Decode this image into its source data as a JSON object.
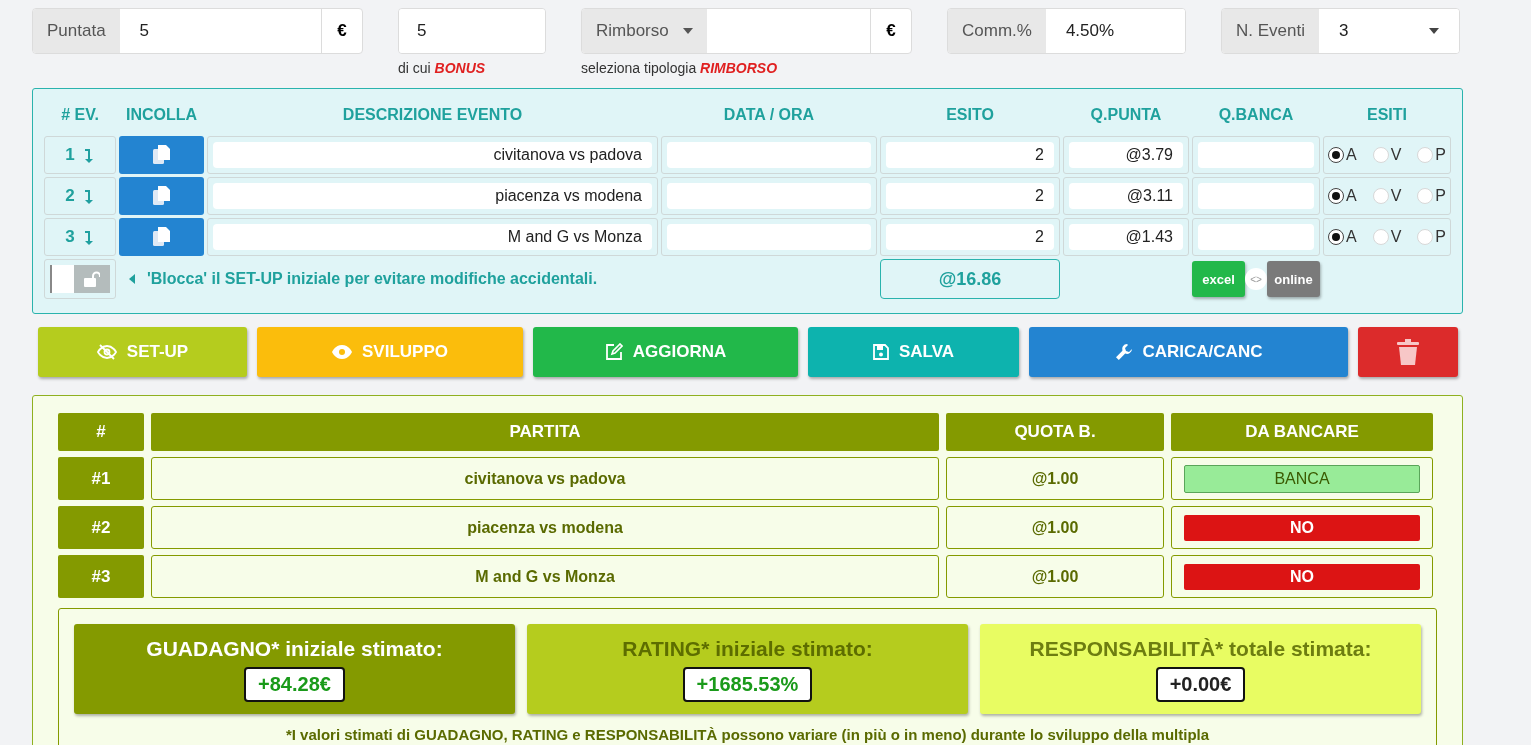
{
  "stake": {
    "label": "Puntata",
    "value": "5",
    "currency": "€"
  },
  "bonus": {
    "value": "5",
    "note_prefix": "di cui",
    "note_highlight": "BONUS"
  },
  "refund": {
    "label": "Rimborso",
    "currency": "€",
    "note_prefix": "seleziona tipologia",
    "note_highlight": "RIMBORSO"
  },
  "commission": {
    "label": "Comm.%",
    "value": "4.50%"
  },
  "event_count": {
    "label": "N. Eventi",
    "value": "3"
  },
  "events_table": {
    "columns": [
      "# EV.",
      "INCOLLA",
      "DESCRIZIONE EVENTO",
      "DATA / ORA",
      "ESITO",
      "Q.PUNTA",
      "Q.BANCA",
      "ESITI"
    ],
    "rows": [
      {
        "number": "1",
        "description": "civitanova vs padova",
        "outcome": "2",
        "q_punta": "@3.79",
        "options": [
          {
            "label": "A",
            "selected": true
          },
          {
            "label": "V",
            "selected": false
          },
          {
            "label": "P",
            "selected": false
          }
        ]
      },
      {
        "number": "2",
        "description": "piacenza vs modena",
        "outcome": "2",
        "q_punta": "@3.11",
        "options": [
          {
            "label": "A",
            "selected": true
          },
          {
            "label": "V",
            "selected": false
          },
          {
            "label": "P",
            "selected": false
          }
        ]
      },
      {
        "number": "3",
        "description": "M and G vs Monza",
        "outcome": "2",
        "q_punta": "@1.43",
        "options": [
          {
            "label": "A",
            "selected": true
          },
          {
            "label": "V",
            "selected": false
          },
          {
            "label": "P",
            "selected": false
          }
        ]
      }
    ],
    "lock": {
      "locked": false,
      "hint": "'Blocca' il SET-UP iniziale per evitare modifiche accidentali."
    },
    "total_odds": "@16.86",
    "switch_knob": "<>",
    "modes": [
      {
        "label": "excel",
        "selected": true
      },
      {
        "label": "online",
        "selected": false
      }
    ]
  },
  "buttons": [
    {
      "kind": "setup",
      "label": "SET-UP",
      "color": "#b5cc1e"
    },
    {
      "kind": "sviluppo",
      "label": "SVILUPPO",
      "color": "#fbbd0c"
    },
    {
      "kind": "aggiorna",
      "label": "AGGIORNA",
      "color": "#22b84a"
    },
    {
      "kind": "salva",
      "label": "SALVA",
      "color": "#0db3ae"
    },
    {
      "kind": "carica",
      "label": "CARICA/CANC",
      "color": "#2384d1"
    },
    {
      "kind": "elimina",
      "color": "#dc2b2b"
    }
  ],
  "results_table": {
    "columns": [
      "#",
      "PARTITA",
      "QUOTA B.",
      "DA BANCARE"
    ],
    "rows": [
      {
        "number": "#1",
        "match": "civitanova vs padova",
        "odds": "@1.00",
        "action": {
          "kind": "banca",
          "label": "BANCA"
        }
      },
      {
        "number": "#2",
        "match": "piacenza vs modena",
        "odds": "@1.00",
        "action": {
          "kind": "no",
          "label": "NO"
        }
      },
      {
        "number": "#3",
        "match": "M and G vs Monza",
        "odds": "@1.00",
        "action": {
          "kind": "no",
          "label": "NO"
        }
      }
    ]
  },
  "summary": [
    {
      "kind": "guadagno",
      "title": "GUADAGNO* iniziale stimato:",
      "value": "+84.28€"
    },
    {
      "kind": "rating",
      "title": "RATING* iniziale stimato:",
      "value": "+1685.53%"
    },
    {
      "kind": "responsabilita",
      "title": "RESPONSABILITÀ* totale stimata:",
      "value": "+0.00€"
    }
  ],
  "footnote": "*I valori stimati di GUADAGNO, RATING e RESPONSABILITÀ possono variare (in più o in meno) durante lo sviluppo della multipla"
}
